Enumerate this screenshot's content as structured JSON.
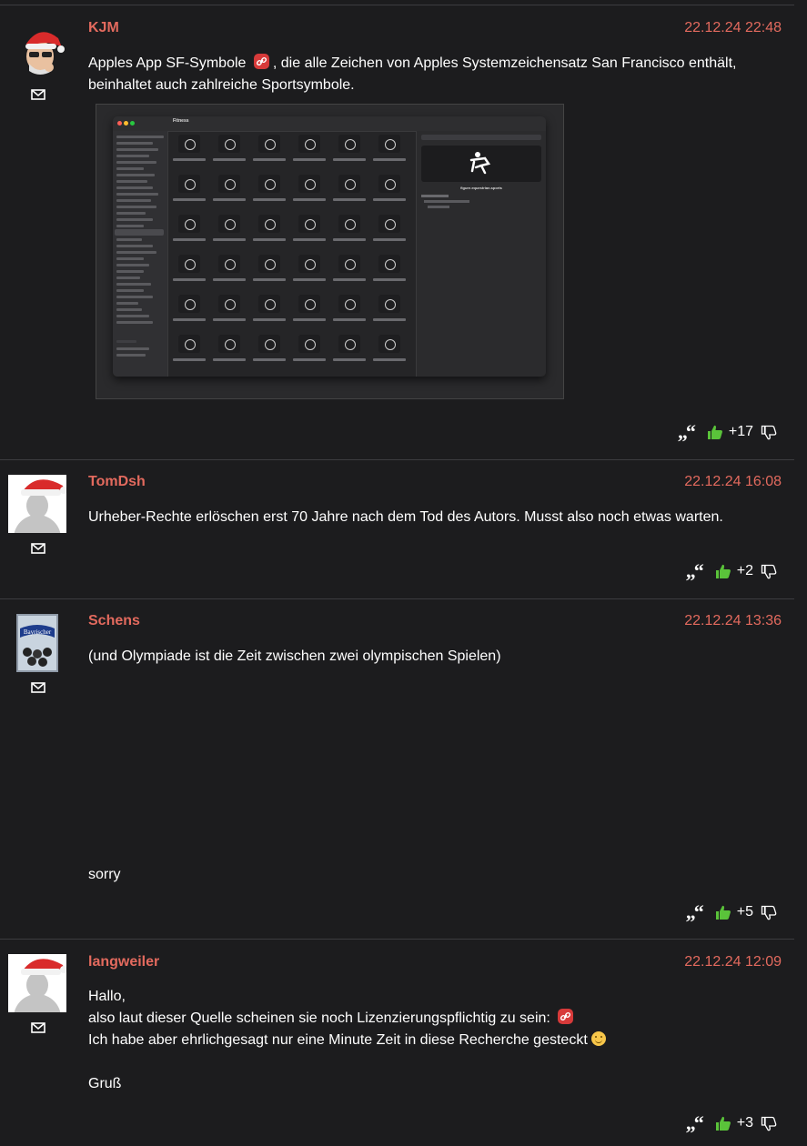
{
  "posts": [
    {
      "author": "KJM",
      "date": "22.12.24",
      "time": "22:48",
      "lines": [
        "Apples App SF-Symbole",
        ", die alle Zeichen von Apples Systemzeichensatz San Francisco enthält,",
        "beinhaltet auch zahlreiche Sportsymbole."
      ],
      "score": "+17"
    },
    {
      "author": "TomDsh",
      "date": "22.12.24",
      "time": "16:08",
      "lines": [
        "Urheber-Rechte erlöschen erst 70 Jahre nach dem Tod des Autors. Musst also noch etwas warten."
      ],
      "score": "+2"
    },
    {
      "author": "Schens",
      "date": "22.12.24",
      "time": "13:36",
      "lines": [
        "(und Olympiade ist die Zeit zwischen zwei olympischen Spielen)",
        "sorry"
      ],
      "score": "+5"
    },
    {
      "author": "langweiler",
      "date": "22.12.24",
      "time": "12:09",
      "lines": [
        "Hallo,",
        "also laut dieser Quelle scheinen sie noch Lizenzierungspflichtig zu sein:",
        "Ich habe aber ehrlichgesagt nur eine Minute Zeit in diese Recherche gesteckt",
        "Gruß"
      ],
      "score": "+3"
    }
  ],
  "screenshot": {
    "window_title": "Fitness",
    "selected_symbol": "figure.equestrian.sports"
  },
  "icons": {
    "mail": "envelope-icon",
    "quote": "quote-icon",
    "upvote": "thumbs-up-icon",
    "downvote": "thumbs-down-icon",
    "link": "link-icon"
  },
  "colors": {
    "background": "#1c1c1e",
    "accent": "#e36a5e",
    "upvote": "#5ac33a"
  }
}
